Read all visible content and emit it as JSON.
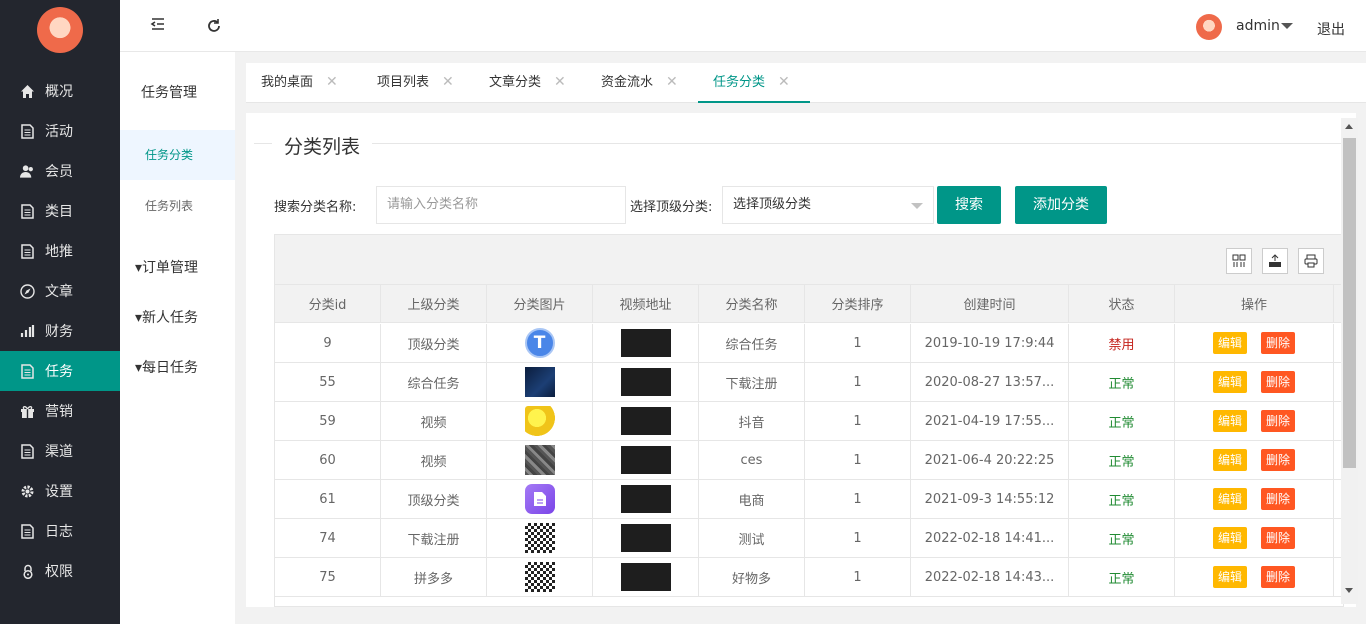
{
  "top": {
    "user": "admin",
    "logout": "退出"
  },
  "nav": [
    {
      "label": "概况",
      "icon": "home-icon"
    },
    {
      "label": "活动",
      "icon": "document-icon"
    },
    {
      "label": "会员",
      "icon": "users-icon"
    },
    {
      "label": "类目",
      "icon": "document-icon"
    },
    {
      "label": "地推",
      "icon": "document-icon"
    },
    {
      "label": "文章",
      "icon": "compass-icon"
    },
    {
      "label": "财务",
      "icon": "bar-chart-icon"
    },
    {
      "label": "任务",
      "icon": "document-icon"
    },
    {
      "label": "营销",
      "icon": "gift-icon"
    },
    {
      "label": "渠道",
      "icon": "document-icon"
    },
    {
      "label": "设置",
      "icon": "gear-icon"
    },
    {
      "label": "日志",
      "icon": "document-icon"
    },
    {
      "label": "权限",
      "icon": "lock-icon"
    }
  ],
  "subnav": {
    "title": "任务管理",
    "items": [
      "任务分类",
      "任务列表"
    ],
    "groups": [
      "▾订单管理",
      "▾新人任务",
      "▾每日任务"
    ]
  },
  "tabs": [
    "我的桌面",
    "项目列表",
    "文章分类",
    "资金流水",
    "任务分类"
  ],
  "page": {
    "title": "分类列表",
    "search_label": "搜索分类名称:",
    "search_placeholder": "请输入分类名称",
    "select_label": "选择顶级分类:",
    "select_value": "选择顶级分类",
    "search_btn": "搜索",
    "add_btn": "添加分类"
  },
  "table": {
    "headers": [
      "分类id",
      "上级分类",
      "分类图片",
      "视频地址",
      "分类名称",
      "分类排序",
      "创建时间",
      "状态",
      "操作"
    ],
    "edit": "编辑",
    "del": "删除",
    "rows": [
      {
        "id": "9",
        "parent": "顶级分类",
        "img": "letter-t-icon",
        "name": "综合任务",
        "sort": "1",
        "time": "2019-10-19 17:9:44",
        "status": "禁用"
      },
      {
        "id": "55",
        "parent": "综合任务",
        "img": "dark-app-thumbnail",
        "name": "下载注册",
        "sort": "1",
        "time": "2020-08-27 13:57...",
        "status": "正常"
      },
      {
        "id": "59",
        "parent": "视频",
        "img": "cartoon-thumbnail",
        "name": "抖音",
        "sort": "1",
        "time": "2021-04-19 17:55...",
        "status": "正常"
      },
      {
        "id": "60",
        "parent": "视频",
        "img": "photo-thumbnail",
        "name": "ces",
        "sort": "1",
        "time": "2021-06-4 20:22:25",
        "status": "正常"
      },
      {
        "id": "61",
        "parent": "顶级分类",
        "img": "purple-doc-icon",
        "name": "电商",
        "sort": "1",
        "time": "2021-09-3 14:55:12",
        "status": "正常"
      },
      {
        "id": "74",
        "parent": "下载注册",
        "img": "qr-code-thumbnail",
        "name": "测试",
        "sort": "1",
        "time": "2022-02-18 14:41...",
        "status": "正常"
      },
      {
        "id": "75",
        "parent": "拼多多",
        "img": "qr-code-thumbnail",
        "name": "好物多",
        "sort": "1",
        "time": "2022-02-18 14:43...",
        "status": "正常"
      }
    ]
  },
  "colors": {
    "accent": "#009688",
    "sidebar": "#23262e",
    "edit": "#ffb800",
    "delete": "#ff5722"
  }
}
